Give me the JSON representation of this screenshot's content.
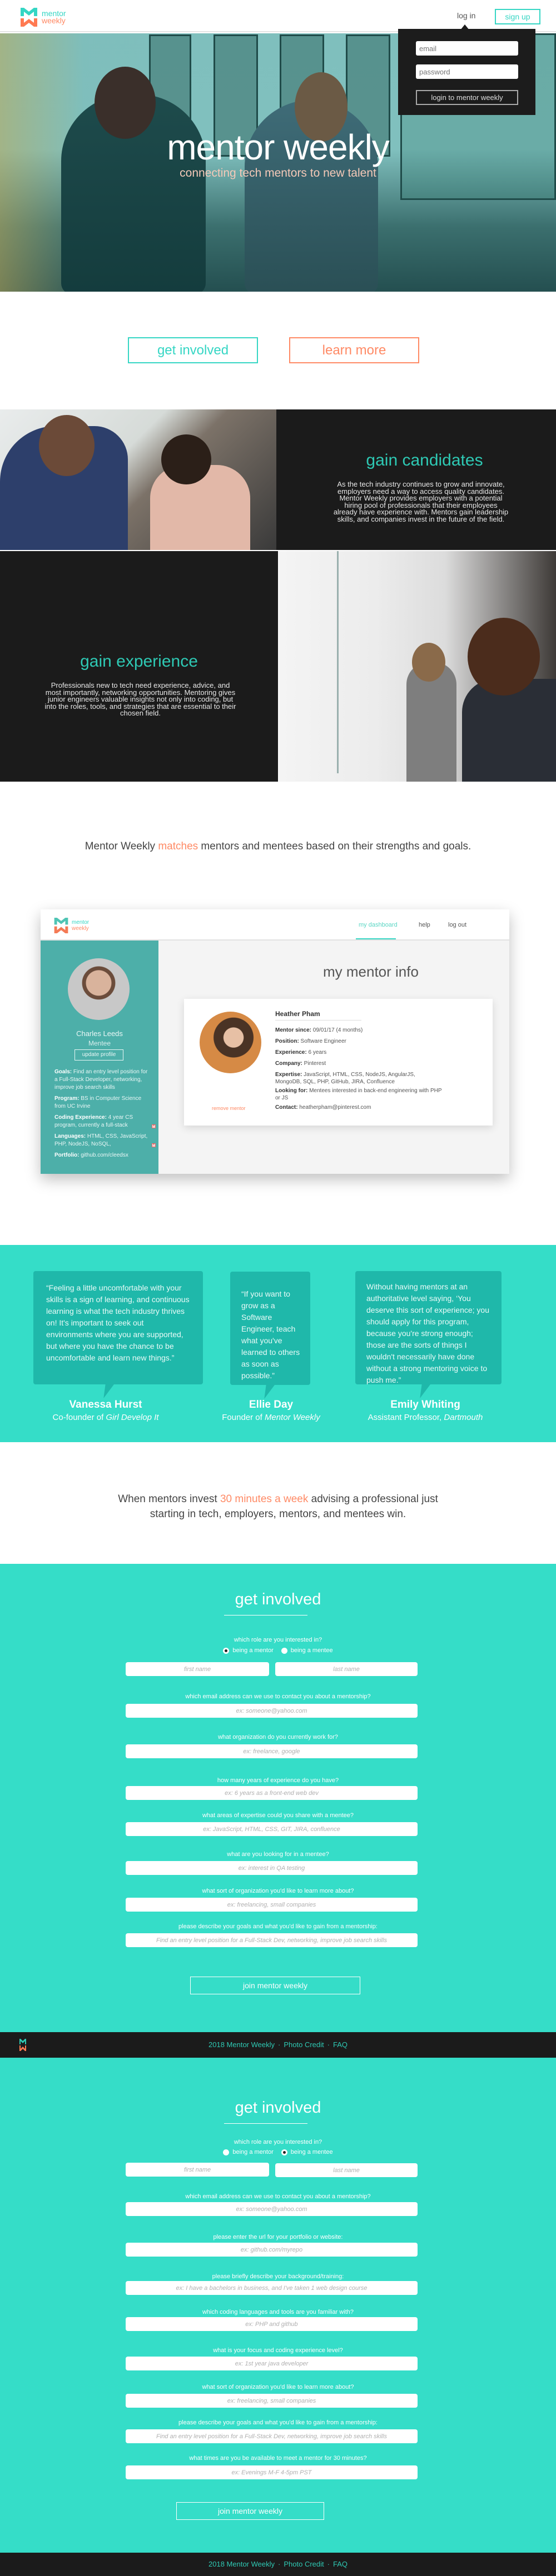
{
  "brand": {
    "name_line1": "mentor",
    "name_line2": "weekly",
    "colors": {
      "teal": "#35d6c4",
      "coral": "#ff8a65",
      "dark": "#1b1b1b"
    }
  },
  "header": {
    "login_label": "log in",
    "signup_label": "sign up"
  },
  "login_popup": {
    "email_placeholder": "email",
    "password_placeholder": "password",
    "submit_label": "login to mentor weekly"
  },
  "hero": {
    "title": "mentor weekly",
    "subtitle": "connecting tech mentors to new talent"
  },
  "cta": {
    "get_involved": "get involved",
    "learn_more": "learn more"
  },
  "features": [
    {
      "title": "gain candidates",
      "body": "As the tech industry continues to grow and innovate, employers need a way to access quality candidates. Mentor Weekly provides employers with a potential hiring pool of professionals that their employees already have experience with. Mentors gain leadership skills, and companies invest in the future of the field."
    },
    {
      "title": "gain experience",
      "body": "Professionals new to tech need experience, advice, and most importantly, networking opportunities. Mentoring gives junior engineers valuable insights not only into coding, but into the roles, tools, and strategies that are essential to their chosen field."
    }
  ],
  "tagline_matches": {
    "before": "Mentor Weekly ",
    "accent": "matches",
    "after": " mentors and mentees based on their strengths and goals."
  },
  "dashboard": {
    "nav": [
      "my dashboard",
      "help",
      "log out"
    ],
    "active_nav": "my dashboard",
    "mentee": {
      "name": "Charles Leeds",
      "role": "Mentee",
      "update_label": "update profile",
      "facts": [
        {
          "label": "Goals:",
          "value": " Find an entry level position for a Full-Stack Developer, networking, improve job search skills"
        },
        {
          "label": "Program:",
          "value": " BS in Computer Science from UC Irvine"
        },
        {
          "label": "Coding Experience:",
          "value": " 4 year CS program, currently a full-stack"
        },
        {
          "label": "Languages:",
          "value": " HTML, CSS, JavaScript, PHP, NodeJS, NoSQL,"
        },
        {
          "label": "Portfolio:",
          "value": " github.com/cleedsx"
        }
      ]
    },
    "page_title": "my mentor info",
    "mentor": {
      "name": "Heather Pham",
      "remove_label": "remove mentor",
      "fields": [
        {
          "label": "Mentor since:",
          "value": " 09/01/17  (4 months)"
        },
        {
          "label": "Position:",
          "value": " Software Engineer"
        },
        {
          "label": "Experience:",
          "value": " 6 years"
        },
        {
          "label": "Company:",
          "value": " Pinterest"
        },
        {
          "label": "Expertise:",
          "value": " JavaScript, HTML, CSS, NodeJS, AngularJS, MongoDB, SQL, PHP, GitHub, JIRA, Confluence"
        },
        {
          "label": "Looking for:",
          "value": " Mentees interested in back-end engineering with PHP or JS"
        },
        {
          "label": "Contact:",
          "value": " heatherpham@pinterest.com"
        }
      ]
    }
  },
  "testimonials": [
    {
      "quote": "“Feeling a little uncomfortable with your skills is a sign of learning, and continuous learning is what the tech industry thrives on! It's important to seek out environments where you are supported, but where you have the chance to be uncomfortable and learn new things.”",
      "name": "Vanessa Hurst",
      "title_prefix": "Co-founder of ",
      "title_org": "Girl Develop It"
    },
    {
      "quote": "“If you want to grow as a Software Engineer, teach what you've learned to others as soon as possible.”",
      "name": "Ellie Day",
      "title_prefix": "Founder of ",
      "title_org": "Mentor Weekly"
    },
    {
      "quote": "Without having mentors at an authoritative level saying, ‘You deserve this sort of experience; you should apply for this program, because you're strong enough; those are the sorts of things I wouldn't necessarily have done without a strong mentoring voice to push me.”",
      "name": "Emily Whiting",
      "title_prefix": "Assistant Professor, ",
      "title_org": "Dartmouth"
    }
  ],
  "tagline_invest": {
    "before": "When mentors invest ",
    "accent": "30 minutes a week",
    "after": " advising a professional just starting in tech, employers, mentors, and mentees win."
  },
  "forms": [
    {
      "title": "get involved",
      "role_question": "which role are you interested in?",
      "roles": [
        "being a mentor",
        "being a mentee"
      ],
      "selected_role": "being a mentor",
      "first_name_placeholder": "first name",
      "last_name_placeholder": "last name",
      "questions": [
        {
          "label": "which email address can we use to contact you about a mentorship?",
          "placeholder": "ex: someone@yahoo.com"
        },
        {
          "label": "what organization do you currently work for?",
          "placeholder": "ex: freelance, google"
        },
        {
          "label": "how many years of experience do you have?",
          "placeholder": "ex: 6 years as a front-end web dev"
        },
        {
          "label": "what areas of expertise could you share with a mentee?",
          "placeholder": "ex: JavaScript, HTML, CSS, GIT, JIRA, confluence"
        },
        {
          "label": "what are you looking for in a mentee?",
          "placeholder": "ex: interest in QA testing"
        },
        {
          "label": "what sort of organization you'd like to learn more about?",
          "placeholder": "ex: freelancing, small companies"
        },
        {
          "label": "please describe your goals and what you'd like to gain from a mentorship:",
          "placeholder": "Find an entry level position for a Full-Stack Dev, networking, improve job search skills"
        }
      ],
      "submit_label": "join mentor weekly"
    },
    {
      "title": "get involved",
      "role_question": "which role are you interested in?",
      "roles": [
        "being a mentor",
        "being a mentee"
      ],
      "selected_role": "being a mentee",
      "first_name_placeholder": "first name",
      "last_name_placeholder": "last name",
      "questions": [
        {
          "label": "which email address can we use to contact you about a mentorship?",
          "placeholder": "ex: someone@yahoo.com"
        },
        {
          "label": "please enter the url for your portfolio or website:",
          "placeholder": "ex: github.com/myrepo"
        },
        {
          "label": "please briefly describe your background/training:",
          "placeholder": "ex: I have a bachelors in business, and I've taken 1 web design course"
        },
        {
          "label": "which coding languages and tools are you familiar with?",
          "placeholder": "ex: PHP and github"
        },
        {
          "label": "what is your focus and coding experience level?",
          "placeholder": "ex: 1st year java developer"
        },
        {
          "label": "what sort of organization you'd like to learn more about?",
          "placeholder": "ex: freelancing, small companies"
        },
        {
          "label": "please describe your goals and what you'd like to gain from a mentorship:",
          "placeholder": "Find an entry level position for a Full-Stack Dev, networking, improve job search skills"
        },
        {
          "label": "what times are you be available to meet a mentor for 30 minutes?",
          "placeholder": "ex: Evenings M-F 4-5pm PST"
        }
      ],
      "submit_label": "join mentor weekly"
    }
  ],
  "footer": {
    "copyright": "2018 Mentor Weekly",
    "links": [
      "Photo Credit",
      "FAQ"
    ],
    "separator": "·"
  }
}
